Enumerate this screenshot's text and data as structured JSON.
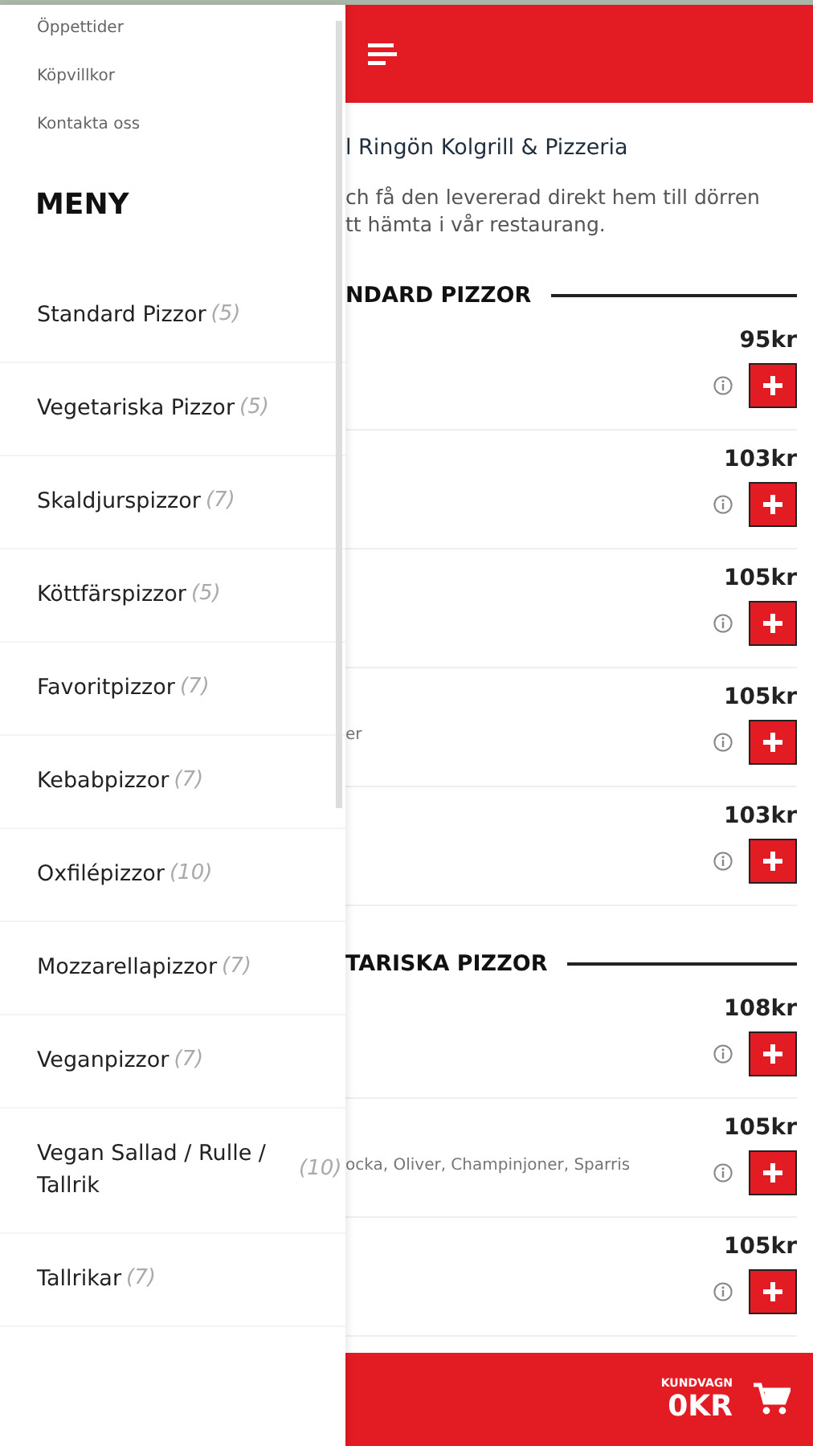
{
  "drawer": {
    "links": [
      "Öppettider",
      "Köpvillkor",
      "Kontakta oss"
    ],
    "menu_title": "MENY",
    "categories": [
      {
        "name": "Standard Pizzor",
        "count": "(5)"
      },
      {
        "name": "Vegetariska Pizzor",
        "count": "(5)"
      },
      {
        "name": "Skaldjurspizzor",
        "count": "(7)"
      },
      {
        "name": "Köttfärspizzor",
        "count": "(5)"
      },
      {
        "name": "Favoritpizzor",
        "count": "(7)"
      },
      {
        "name": "Kebabpizzor",
        "count": "(7)"
      },
      {
        "name": "Oxfilépizzor",
        "count": "(10)"
      },
      {
        "name": "Mozzarellapizzor",
        "count": "(7)"
      },
      {
        "name": "Veganpizzor",
        "count": "(7)"
      },
      {
        "name": "Vegan Sallad / Rulle / Tallrik",
        "count": "(10)"
      },
      {
        "name": "Tallrikar",
        "count": "(7)"
      }
    ]
  },
  "main": {
    "title": "l Ringön Kolgrill & Pizzeria",
    "intro": [
      "ch få den levererad direkt hem till dörren",
      "tt hämta i vår restaurang."
    ],
    "sections": [
      {
        "heading": "NDARD PIZZOR",
        "items": [
          {
            "price": "95kr"
          },
          {
            "price": "103kr"
          },
          {
            "price": "105kr"
          },
          {
            "price": "105kr",
            "description": "er"
          },
          {
            "price": "103kr"
          }
        ]
      },
      {
        "heading": "TARISKA PIZZOR",
        "items": [
          {
            "price": "108kr"
          },
          {
            "price": "105kr",
            "description": "ocka, Oliver, Champinjoner, Sparris"
          },
          {
            "price": "105kr"
          }
        ]
      }
    ]
  },
  "cart": {
    "label": "KUNDVAGN",
    "total": "0KR"
  }
}
